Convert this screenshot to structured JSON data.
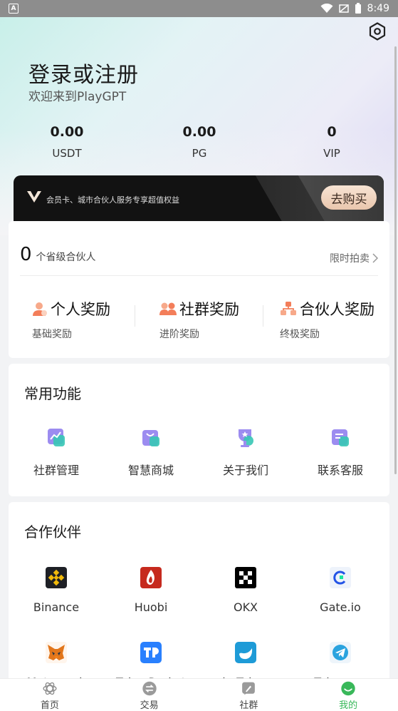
{
  "status_bar": {
    "app_badge": "A",
    "time": "8:49"
  },
  "header": {
    "title": "登录或注册",
    "subtitle": "欢迎来到PlayGPT",
    "stats": [
      {
        "value": "0.00",
        "label": "USDT"
      },
      {
        "value": "0.00",
        "label": "PG"
      },
      {
        "value": "0",
        "label": "VIP"
      }
    ]
  },
  "vip_banner": {
    "text": "会员卡、城市合伙人服务专享超值权益",
    "buy_label": "去购买"
  },
  "partners_card": {
    "count": "0",
    "count_label": "个省级合伙人",
    "flash_sale": "限时拍卖",
    "rewards": [
      {
        "title": "个人奖励",
        "sub": "基础奖励",
        "icon": "person-reward-icon"
      },
      {
        "title": "社群奖励",
        "sub": "进阶奖励",
        "icon": "community-reward-icon"
      },
      {
        "title": "合伙人奖励",
        "sub": "终极奖励",
        "icon": "partner-reward-icon"
      }
    ]
  },
  "functions": {
    "title": "常用功能",
    "items": [
      {
        "label": "社群管理",
        "icon": "chart-icon"
      },
      {
        "label": "智慧商城",
        "icon": "shopping-bag-icon"
      },
      {
        "label": "关于我们",
        "icon": "trophy-icon"
      },
      {
        "label": "联系客服",
        "icon": "contact-icon"
      }
    ]
  },
  "cooperation": {
    "title": "合作伙伴",
    "items": [
      {
        "label": "Binance",
        "icon": "binance-icon"
      },
      {
        "label": "Huobi",
        "icon": "huobi-icon"
      },
      {
        "label": "OKX",
        "icon": "okx-icon"
      },
      {
        "label": "Gate.io",
        "icon": "gateio-icon"
      },
      {
        "label": "Metamask",
        "icon": "metamask-icon"
      },
      {
        "label": "TokenPocket",
        "icon": "tokenpocket-icon"
      },
      {
        "label": "imToken",
        "icon": "imtoken-icon"
      },
      {
        "label": "Telegram",
        "icon": "telegram-icon"
      }
    ]
  },
  "bottom_nav": {
    "items": [
      {
        "label": "首页",
        "icon": "home-icon"
      },
      {
        "label": "交易",
        "icon": "exchange-icon"
      },
      {
        "label": "社群",
        "icon": "community-icon"
      },
      {
        "label": "我的",
        "icon": "profile-icon"
      }
    ],
    "active_index": 3,
    "active_color": "#39b85a"
  }
}
